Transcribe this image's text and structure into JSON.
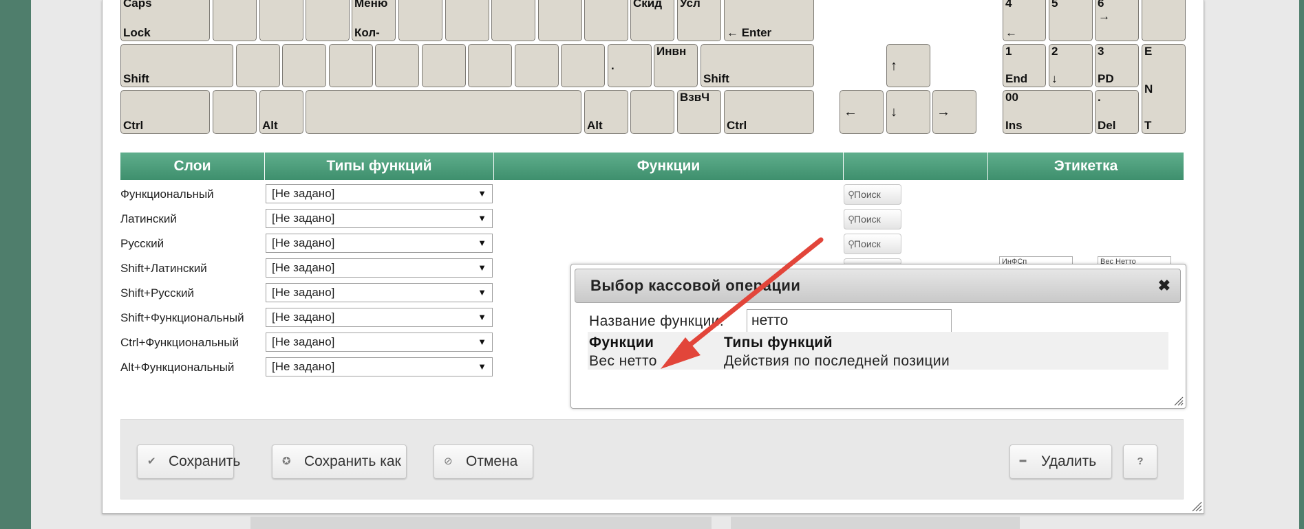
{
  "keyboard": {
    "caps_top": "Caps",
    "caps_bottom": "Lock",
    "menu_top": "Меню",
    "menu_bottom": "Кол-",
    "skid": "Скид",
    "usl": "Усл",
    "enter": "← Enter",
    "shift_left": "Shift",
    "dot": ".",
    "invn": "Инвн",
    "shift_right": "Shift",
    "ctrl_left": "Ctrl",
    "alt_left": "Alt",
    "alt_right": "Alt",
    "vzvch": "ВзвЧ",
    "ctrl_right": "Ctrl",
    "arrow_up": "↑",
    "arrow_left": "←",
    "arrow_down": "↓",
    "arrow_right": "→",
    "num4": "4",
    "num4_sub": "←",
    "num5": "5",
    "num6": "6",
    "num6_sub": "→",
    "num1": "1",
    "num1_sub": "End",
    "num2": "2",
    "num2_sub": "↓",
    "num3": "3",
    "num3_sub": "PD",
    "ent_e": "E",
    "ent_n": "N",
    "ent_t": "T",
    "num00": "00",
    "num00_sub": "Ins",
    "numdot": ".",
    "numdot_sub": "Del"
  },
  "layers_table": {
    "headers": [
      "Слои",
      "Типы функций",
      "Функции",
      "",
      "Этикетка"
    ],
    "rows": [
      {
        "layer": "Функциональный",
        "type": "[Не задано]"
      },
      {
        "layer": "Латинский",
        "type": "[Не задано]"
      },
      {
        "layer": "Русский",
        "type": "[Не задано]"
      },
      {
        "layer": "Shift+Латинский",
        "type": "[Не задано]"
      },
      {
        "layer": "Shift+Русский",
        "type": "[Не задано]"
      },
      {
        "layer": "Shift+Функциональный",
        "type": "[Не задано]"
      },
      {
        "layer": "Ctrl+Функциональный",
        "type": "[Не задано]"
      },
      {
        "layer": "Alt+Функциональный",
        "type": "[Не задано]"
      }
    ],
    "search_label": "Поиск",
    "partial_inputs": [
      "ИнФСп",
      "Вес Нетто"
    ]
  },
  "popup": {
    "title": "Выбор кассовой операции",
    "close": "✖",
    "function_name_label": "Название функции:",
    "function_name_value": "нетто",
    "col_functions": "Функции",
    "col_types": "Типы функций",
    "result_function": "Вес нетто",
    "result_type": "Действия по последней позиции"
  },
  "footer": {
    "save": "Сохранить",
    "save_as": "Сохранить как",
    "cancel": "Отмена",
    "delete": "Удалить",
    "help": "?"
  },
  "colors": {
    "background": "#4f7e6c",
    "header_green": "#4d9e7c",
    "key_face": "#dcd8ce",
    "arrow_red": "#e2453a"
  },
  "icons": [
    "check-icon",
    "check-circle-icon",
    "ban-icon",
    "minus-icon",
    "magnifier-icon",
    "close-icon"
  ]
}
